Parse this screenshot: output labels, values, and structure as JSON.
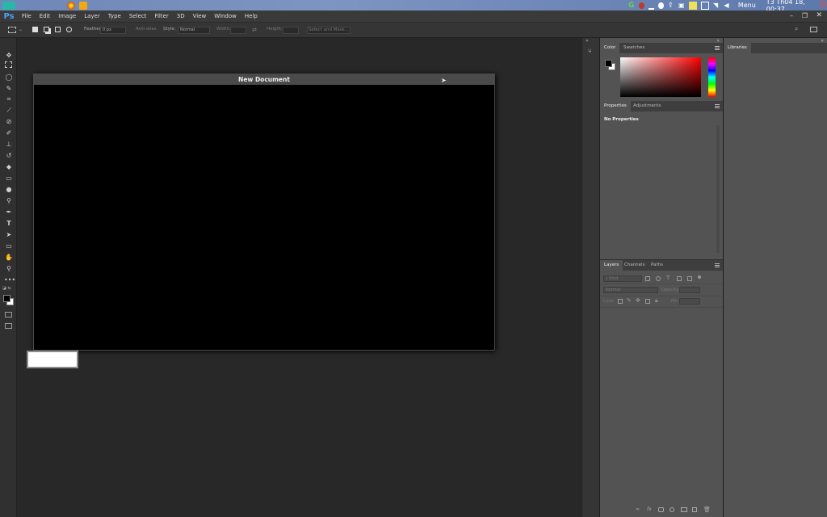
{
  "os": {
    "clock": "T3 Th04 18, 00:37",
    "menu_label": "Menu",
    "tray_icons": [
      "app-launcher-icon",
      "firefox-icon",
      "files-icon",
      "g-badge-icon",
      "record-icon",
      "chat-icon",
      "upload-icon",
      "lock-icon",
      "notes-icon",
      "monitor-icon",
      "wifi-icon",
      "volume-icon",
      "power-icon"
    ]
  },
  "app": {
    "logo": "Ps",
    "menu": [
      "File",
      "Edit",
      "Image",
      "Layer",
      "Type",
      "Select",
      "Filter",
      "3D",
      "View",
      "Window",
      "Help"
    ]
  },
  "options": {
    "feather_label": "Feather:",
    "feather_value": "0 px",
    "antialias_label": "Anti-alias",
    "style_label": "Style:",
    "style_value": "Normal",
    "width_label": "Width:",
    "height_label": "Height:",
    "select_mask_label": "Select and Mask..."
  },
  "document": {
    "title": "New Document"
  },
  "tools": [
    "move-tool-icon",
    "marquee-tool-icon",
    "lasso-tool-icon",
    "quick-select-tool-icon",
    "crop-tool-icon",
    "eyedropper-tool-icon",
    "healing-brush-tool-icon",
    "brush-tool-icon",
    "clone-stamp-tool-icon",
    "history-brush-tool-icon",
    "eraser-tool-icon",
    "gradient-tool-icon",
    "blur-tool-icon",
    "dodge-tool-icon",
    "pen-tool-icon",
    "type-tool-icon",
    "path-select-tool-icon",
    "rectangle-tool-icon",
    "hand-tool-icon",
    "zoom-tool-icon",
    "more-tools-icon"
  ],
  "panels": {
    "color_tabs": [
      "Color",
      "Swatches"
    ],
    "properties_tabs": [
      "Properties",
      "Adjustments"
    ],
    "no_properties": "No Properties",
    "layers_tabs": [
      "Layers",
      "Channels",
      "Paths"
    ],
    "layers_search": "Kind",
    "blend_mode": "Normal",
    "opacity_label": "Opacity:",
    "lock_label": "Lock:",
    "fill_label": "Fill:",
    "libraries_tab": "Libraries"
  },
  "colors": {
    "foreground": "#000000",
    "background": "#ffffff",
    "picker_hue": "#ff0000"
  }
}
